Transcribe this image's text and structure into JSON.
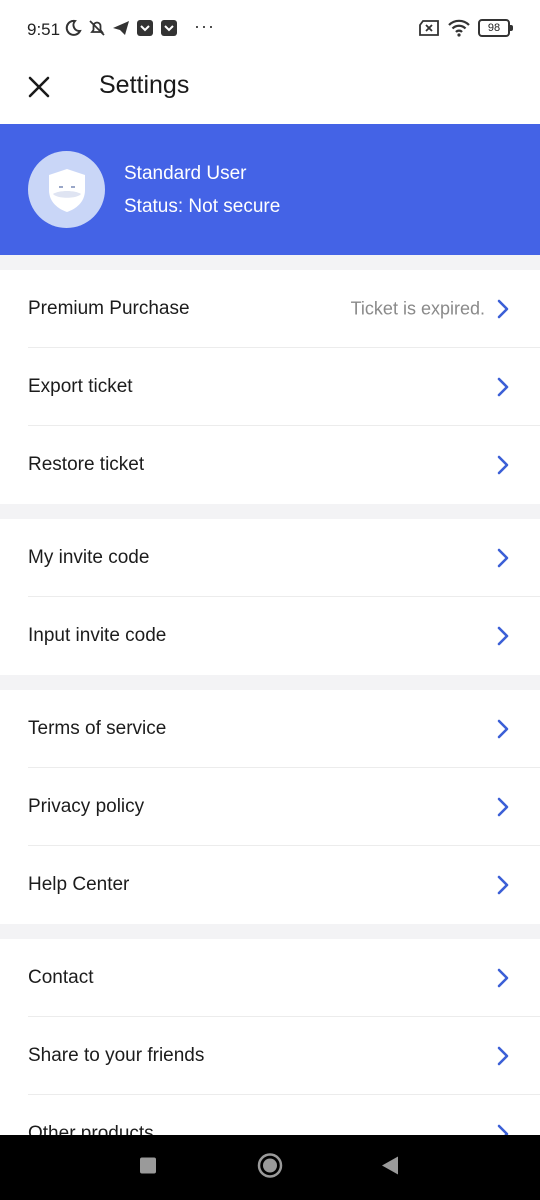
{
  "status_bar": {
    "time": "9:51",
    "dots": "···",
    "battery": "98"
  },
  "header": {
    "title": "Settings",
    "close_icon": "close-icon"
  },
  "user": {
    "name": "Standard User",
    "status": "Status: Not secure",
    "avatar_icon": "shield-face-icon"
  },
  "colors": {
    "accent": "#4463e6",
    "chevron": "#3b5fd6",
    "section_gap": "#f3f3f5"
  },
  "sections": [
    {
      "items": [
        {
          "label": "Premium Purchase",
          "value": "Ticket is expired."
        },
        {
          "label": "Export ticket",
          "value": ""
        },
        {
          "label": "Restore ticket",
          "value": ""
        }
      ]
    },
    {
      "items": [
        {
          "label": "My invite code",
          "value": ""
        },
        {
          "label": "Input invite code",
          "value": ""
        }
      ]
    },
    {
      "items": [
        {
          "label": "Terms of service",
          "value": ""
        },
        {
          "label": "Privacy policy",
          "value": ""
        },
        {
          "label": "Help Center",
          "value": ""
        }
      ]
    },
    {
      "items": [
        {
          "label": "Contact",
          "value": ""
        },
        {
          "label": "Share to your friends",
          "value": ""
        },
        {
          "label": "Other products",
          "value": ""
        }
      ]
    }
  ]
}
